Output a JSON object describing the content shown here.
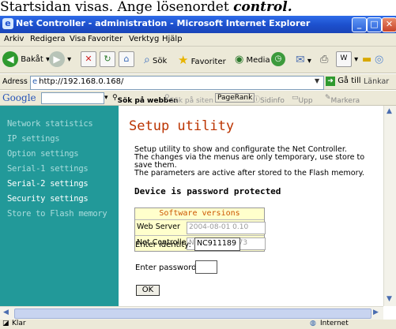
{
  "caption": {
    "text": "Startsidan visas. Ange lösenordet ",
    "keyword": "control."
  },
  "window": {
    "title": "Net Controller - administration - Microsoft Internet Explorer"
  },
  "menu": [
    "Arkiv",
    "Redigera",
    "Visa",
    "Favoriter",
    "Verktyg",
    "Hjälp"
  ],
  "toolbar": {
    "back": "Bakåt",
    "search": "Sök",
    "favorites": "Favoriter",
    "media": "Media"
  },
  "address": {
    "label": "Adress",
    "url": "http://192.168.0.168/",
    "go": "Gå till",
    "links": "Länkar"
  },
  "google_bar": {
    "logo": "Google",
    "search_web": "Sök på webben",
    "search_site": "Sök på siten",
    "pagerank": "PageRank",
    "info": "Sidinfo",
    "up": "Upp",
    "highlight": "Markera"
  },
  "sidebar": {
    "items": [
      {
        "label": "Network statistics"
      },
      {
        "label": "IP settings"
      },
      {
        "label": "Option settings"
      },
      {
        "label": "Serial-1 settings"
      },
      {
        "label": "Serial-2 settings"
      },
      {
        "label": "Security settings"
      },
      {
        "label": "Store to Flash memory"
      }
    ]
  },
  "main": {
    "heading": "Setup utility",
    "para1": "Setup utility to show and configurate the Net Controller.",
    "para2": "The changes via the menus are only temporary, use store to save them.",
    "para3": "The parameters are active after stored to the Flash memory.",
    "protected": "Device is password protected",
    "sw_table": {
      "title": "Software versions",
      "rows": [
        {
          "label": "Web Server",
          "value": "2004-08-01 0.10"
        },
        {
          "label": "Net Controller",
          "value": "NC200 STD 0.73"
        }
      ]
    },
    "identity_label": "Enter identity:",
    "identity_value": "NC911189",
    "password_label": "Enter password:",
    "password_value": "",
    "ok": "OK"
  },
  "status": {
    "left": "Klar",
    "zone": "Internet"
  },
  "colors": {
    "sidebar": "#229999",
    "heading": "#bb3300",
    "table_bg": "#ffffcc",
    "title_bar": "#1c4fcc"
  }
}
